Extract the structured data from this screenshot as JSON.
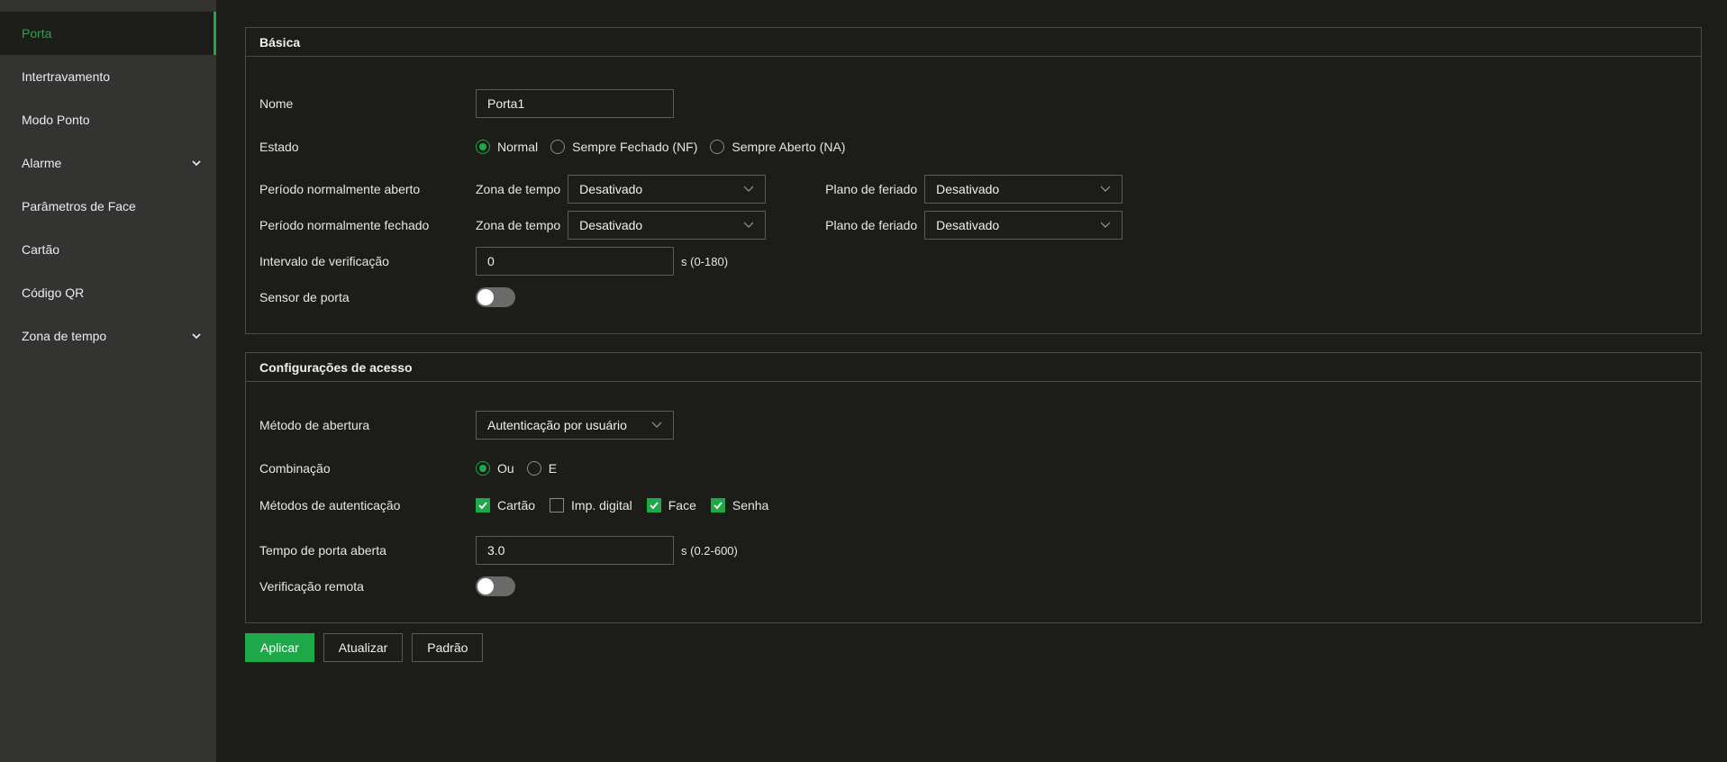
{
  "sidebar": {
    "items": [
      {
        "label": "Porta",
        "active": true,
        "expandable": false
      },
      {
        "label": "Intertravamento",
        "active": false,
        "expandable": false
      },
      {
        "label": "Modo Ponto",
        "active": false,
        "expandable": false
      },
      {
        "label": "Alarme",
        "active": false,
        "expandable": true
      },
      {
        "label": "Parâmetros de Face",
        "active": false,
        "expandable": false
      },
      {
        "label": "Cartão",
        "active": false,
        "expandable": false
      },
      {
        "label": "Código QR",
        "active": false,
        "expandable": false
      },
      {
        "label": "Zona de tempo",
        "active": false,
        "expandable": true
      }
    ]
  },
  "basic": {
    "title": "Básica",
    "name_label": "Nome",
    "name_value": "Porta1",
    "state_label": "Estado",
    "state_options": [
      "Normal",
      "Sempre Fechado (NF)",
      "Sempre Aberto (NA)"
    ],
    "state_selected": "Normal",
    "normally_open_label": "Período normalmente aberto",
    "normally_closed_label": "Período normalmente fechado",
    "time_zone_label": "Zona de tempo",
    "holiday_plan_label": "Plano de feriado",
    "open_time_zone": "Desativado",
    "open_holiday_plan": "Desativado",
    "closed_time_zone": "Desativado",
    "closed_holiday_plan": "Desativado",
    "interval_label": "Intervalo de verificação",
    "interval_value": "0",
    "interval_unit": "s (0-180)",
    "sensor_label": "Sensor de porta",
    "sensor_on": false
  },
  "access": {
    "title": "Configurações de acesso",
    "method_label": "Método de abertura",
    "method_value": "Autenticação por usuário",
    "combination_label": "Combinação",
    "combination_options": [
      "Ou",
      "E"
    ],
    "combination_selected": "Ou",
    "auth_methods_label": "Métodos de autenticação",
    "auth_methods": [
      {
        "label": "Cartão",
        "checked": true
      },
      {
        "label": "Imp. digital",
        "checked": false
      },
      {
        "label": "Face",
        "checked": true
      },
      {
        "label": "Senha",
        "checked": true
      }
    ],
    "open_time_label": "Tempo de porta aberta",
    "open_time_value": "3.0",
    "open_time_unit": "s (0.2-600)",
    "remote_label": "Verificação remota",
    "remote_on": false
  },
  "buttons": {
    "apply": "Aplicar",
    "refresh": "Atualizar",
    "default": "Padrão"
  },
  "colors": {
    "accent": "#1fa84a",
    "background": "#1c1d19",
    "sidebar": "#333432"
  }
}
